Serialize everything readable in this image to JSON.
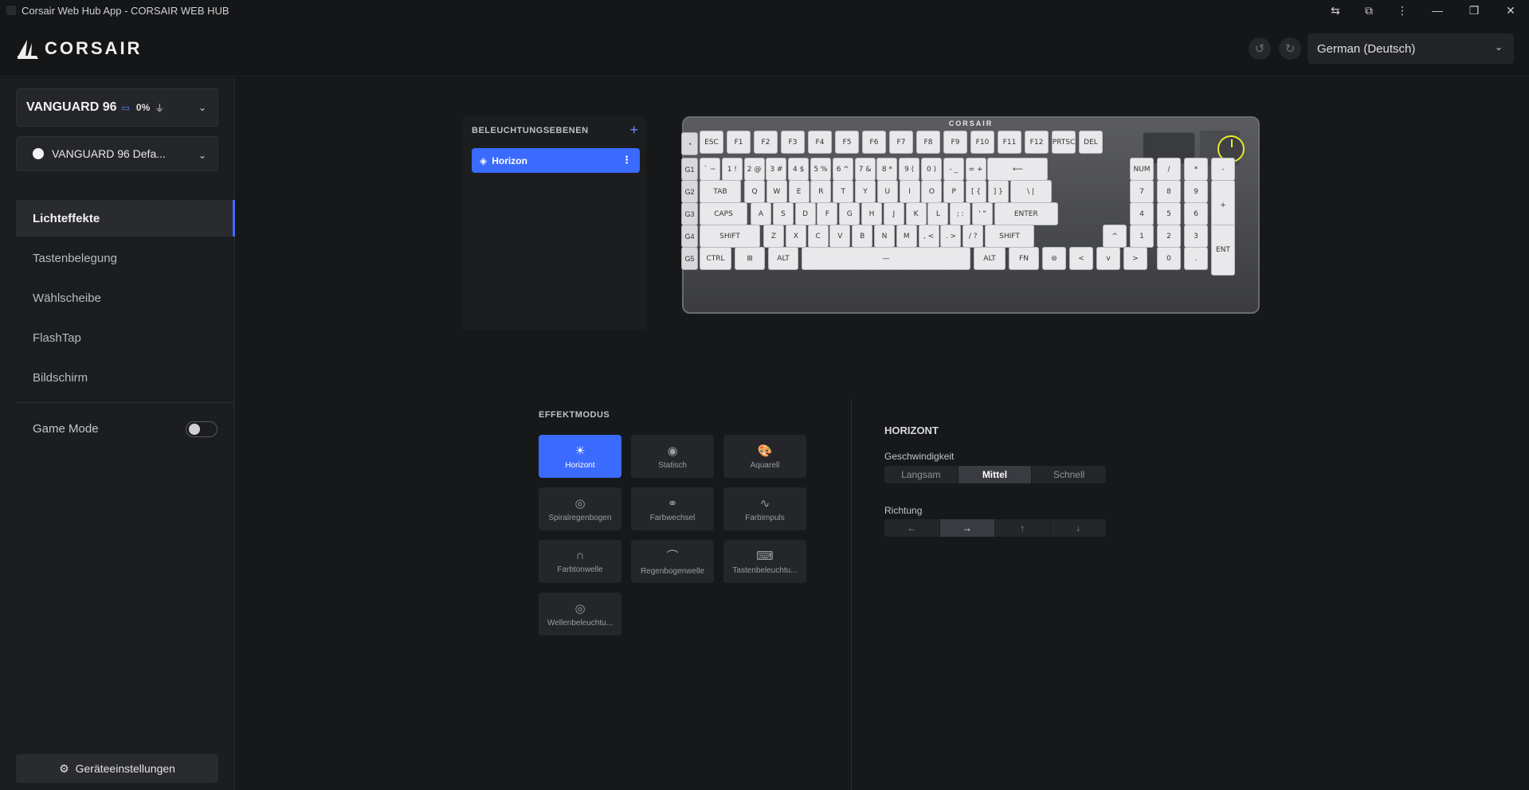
{
  "window": {
    "title": "Corsair Web Hub App - CORSAIR WEB HUB",
    "controls": [
      "translate-icon",
      "extensions-icon",
      "more-icon",
      "minimize-icon",
      "restore-icon",
      "close-icon"
    ]
  },
  "header": {
    "brand": "CORSAIR",
    "language": "German (Deutsch)"
  },
  "sidebar": {
    "device_name": "VANGUARD 96",
    "battery": "0%",
    "profile": "VANGUARD 96 Defa...",
    "nav": [
      {
        "label": "Lichteffekte",
        "active": true
      },
      {
        "label": "Tastenbelegung",
        "active": false
      },
      {
        "label": "Wählscheibe",
        "active": false
      },
      {
        "label": "FlashTap",
        "active": false
      },
      {
        "label": "Bildschirm",
        "active": false
      }
    ],
    "game_mode_label": "Game Mode",
    "game_mode_on": false,
    "settings_label": "Geräteeinstellungen"
  },
  "layers": {
    "title": "BELEUCHTUNGSEBENEN",
    "items": [
      "Horizon"
    ]
  },
  "keyboard": {
    "brand": "CORSAIR",
    "g_keys": [
      "G1",
      "G2",
      "G3",
      "G4",
      "G5"
    ],
    "row0": [
      "ESC",
      "F1",
      "F2",
      "F3",
      "F4",
      "F5",
      "F6",
      "F7",
      "F8",
      "F9",
      "F10",
      "F11",
      "F12",
      "PRTSC",
      "DEL"
    ],
    "row1": [
      "` ~",
      "1 !",
      "2 @",
      "3 #",
      "4 $",
      "5 %",
      "6 ^",
      "7 &",
      "8 *",
      "9 (",
      "0 )",
      "- _",
      "= +",
      "⟵",
      "NUM",
      "/",
      "*",
      "-"
    ],
    "row2": [
      "TAB",
      "Q",
      "W",
      "E",
      "R",
      "T",
      "Y",
      "U",
      "I",
      "O",
      "P",
      "[ {",
      "] }",
      "\\ |",
      "7",
      "8",
      "9",
      "+"
    ],
    "row3": [
      "CAPS",
      "A",
      "S",
      "D",
      "F",
      "G",
      "H",
      "J",
      "K",
      "L",
      "; :",
      "' \"",
      "ENTER",
      "4",
      "5",
      "6"
    ],
    "row4": [
      "SHIFT",
      "Z",
      "X",
      "C",
      "V",
      "B",
      "N",
      "M",
      ", <",
      ". >",
      "/ ?",
      "SHIFT",
      "^",
      "1",
      "2",
      "3",
      "ENT"
    ],
    "row5": [
      "CTRL",
      "⊞",
      "ALT",
      "—",
      "ALT",
      "FN",
      "⊚",
      "<",
      "v",
      ">",
      "0",
      "."
    ]
  },
  "effects": {
    "title": "EFFEKTMODUS",
    "items": [
      {
        "label": "Horizont",
        "icon": "sunrise-icon",
        "glyph": "☀",
        "active": true
      },
      {
        "label": "Statisch",
        "icon": "target-icon",
        "glyph": "◉",
        "active": false
      },
      {
        "label": "Aquarell",
        "icon": "palette-icon",
        "glyph": "🎨",
        "active": false
      },
      {
        "label": "Spiralregenbogen",
        "icon": "spiral-icon",
        "glyph": "◎",
        "active": false
      },
      {
        "label": "Farbwechsel",
        "icon": "link-icon",
        "glyph": "⚭",
        "active": false
      },
      {
        "label": "Farbimpuls",
        "icon": "pulse-icon",
        "glyph": "∿",
        "active": false
      },
      {
        "label": "Farbtonwelle",
        "icon": "wave-icon",
        "glyph": "∩",
        "active": false
      },
      {
        "label": "Regenbogenwelle",
        "icon": "rainbow-icon",
        "glyph": "⌒",
        "active": false
      },
      {
        "label": "Tastenbeleuchtu...",
        "icon": "keyboard-icon",
        "glyph": "⌨",
        "active": false
      },
      {
        "label": "Wellenbeleuchtu...",
        "icon": "ripple-icon",
        "glyph": "◎",
        "active": false
      }
    ]
  },
  "settings": {
    "title": "HORIZONT",
    "speed_label": "Geschwindigkeit",
    "speed_options": [
      "Langsam",
      "Mittel",
      "Schnell"
    ],
    "speed_selected": "Mittel",
    "direction_label": "Richtung",
    "direction_options": [
      "←",
      "→",
      "↑",
      "↓"
    ],
    "direction_selected": "→"
  },
  "colors": {
    "accent": "#3b6aff",
    "dial_highlight": "#e8e82a"
  }
}
